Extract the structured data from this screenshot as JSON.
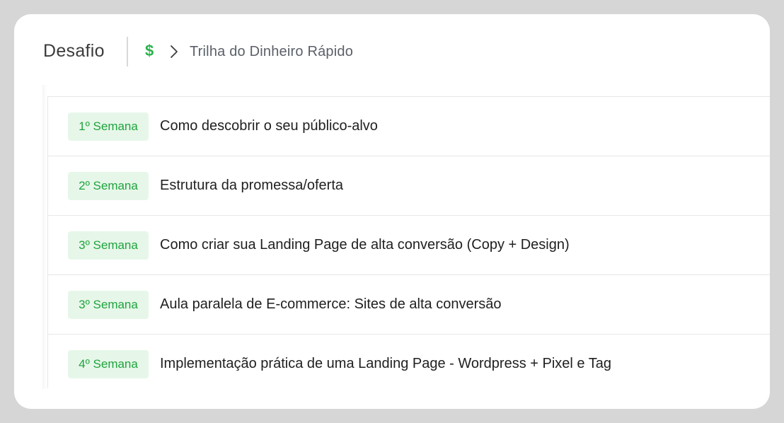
{
  "header": {
    "title": "Desafio",
    "currency_icon": "$",
    "breadcrumb": "Trilha do Dinheiro Rápido"
  },
  "lessons": [
    {
      "week": "1º Semana",
      "title": "Como descobrir o seu público-alvo"
    },
    {
      "week": "2º Semana",
      "title": "Estrutura da promessa/oferta"
    },
    {
      "week": "3º Semana",
      "title": "Como criar sua Landing Page de alta conversão (Copy + Design)"
    },
    {
      "week": "3º Semana",
      "title": "Aula paralela de E-commerce: Sites de alta conversão"
    },
    {
      "week": "4º Semana",
      "title": "Implementação prática de uma Landing Page - Wordpress + Pixel e Tag"
    }
  ],
  "colors": {
    "accent_green": "#2bb24c",
    "badge_bg": "#e6f7e9",
    "badge_text": "#1fa33d"
  }
}
